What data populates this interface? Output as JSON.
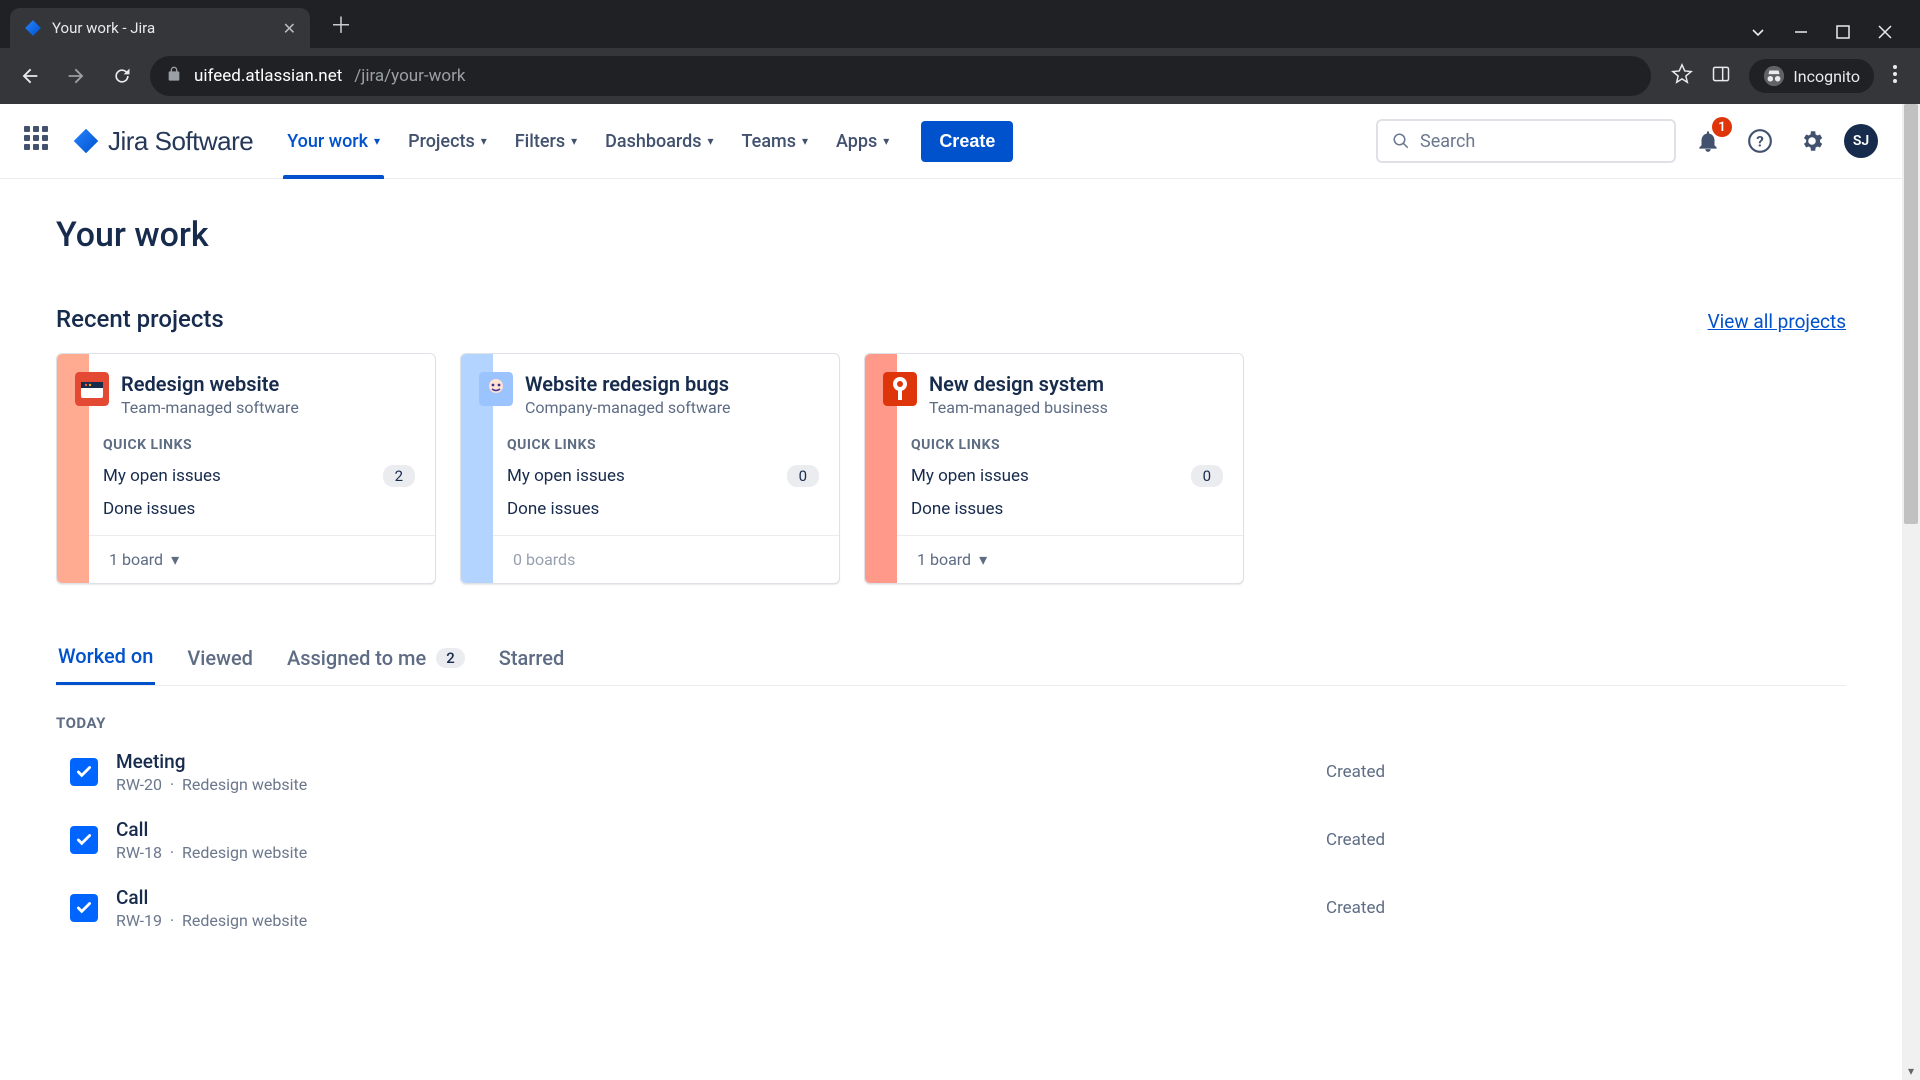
{
  "browser": {
    "tab_title": "Your work - Jira",
    "url_host": "uifeed.atlassian.net",
    "url_path": "/jira/your-work",
    "incognito_label": "Incognito"
  },
  "nav": {
    "product": "Jira Software",
    "items": [
      {
        "label": "Your work",
        "active": true
      },
      {
        "label": "Projects",
        "active": false
      },
      {
        "label": "Filters",
        "active": false
      },
      {
        "label": "Dashboards",
        "active": false
      },
      {
        "label": "Teams",
        "active": false
      },
      {
        "label": "Apps",
        "active": false
      }
    ],
    "create_label": "Create",
    "search_placeholder": "Search",
    "notification_count": "1",
    "avatar_initials": "SJ"
  },
  "page": {
    "title": "Your work",
    "recent_heading": "Recent projects",
    "view_all_label": "View all projects",
    "quick_links_label": "QUICK LINKS",
    "my_open_issues_label": "My open issues",
    "done_issues_label": "Done issues",
    "projects": [
      {
        "name": "Redesign website",
        "subtitle": "Team-managed software",
        "open_count": "2",
        "boards": "1 board",
        "stripe": "#ffab91",
        "icon_bg": "#e34933",
        "has_dropdown": true
      },
      {
        "name": "Website redesign bugs",
        "subtitle": "Company-managed software",
        "open_count": "0",
        "boards": "0 boards",
        "stripe": "#b3d4ff",
        "icon_bg": "#9bc4ff",
        "has_dropdown": false
      },
      {
        "name": "New design system",
        "subtitle": "Team-managed business",
        "open_count": "0",
        "boards": "1 board",
        "stripe": "#ff9a8b",
        "icon_bg": "#de350b",
        "has_dropdown": true
      }
    ],
    "tabs": [
      {
        "label": "Worked on",
        "active": true,
        "count": null
      },
      {
        "label": "Viewed",
        "active": false,
        "count": null
      },
      {
        "label": "Assigned to me",
        "active": false,
        "count": "2"
      },
      {
        "label": "Starred",
        "active": false,
        "count": null
      }
    ],
    "group_today": "TODAY",
    "issues": [
      {
        "title": "Meeting",
        "key": "RW-20",
        "project": "Redesign website",
        "status": "Created"
      },
      {
        "title": "Call",
        "key": "RW-18",
        "project": "Redesign website",
        "status": "Created"
      },
      {
        "title": "Call",
        "key": "RW-19",
        "project": "Redesign website",
        "status": "Created"
      }
    ]
  }
}
